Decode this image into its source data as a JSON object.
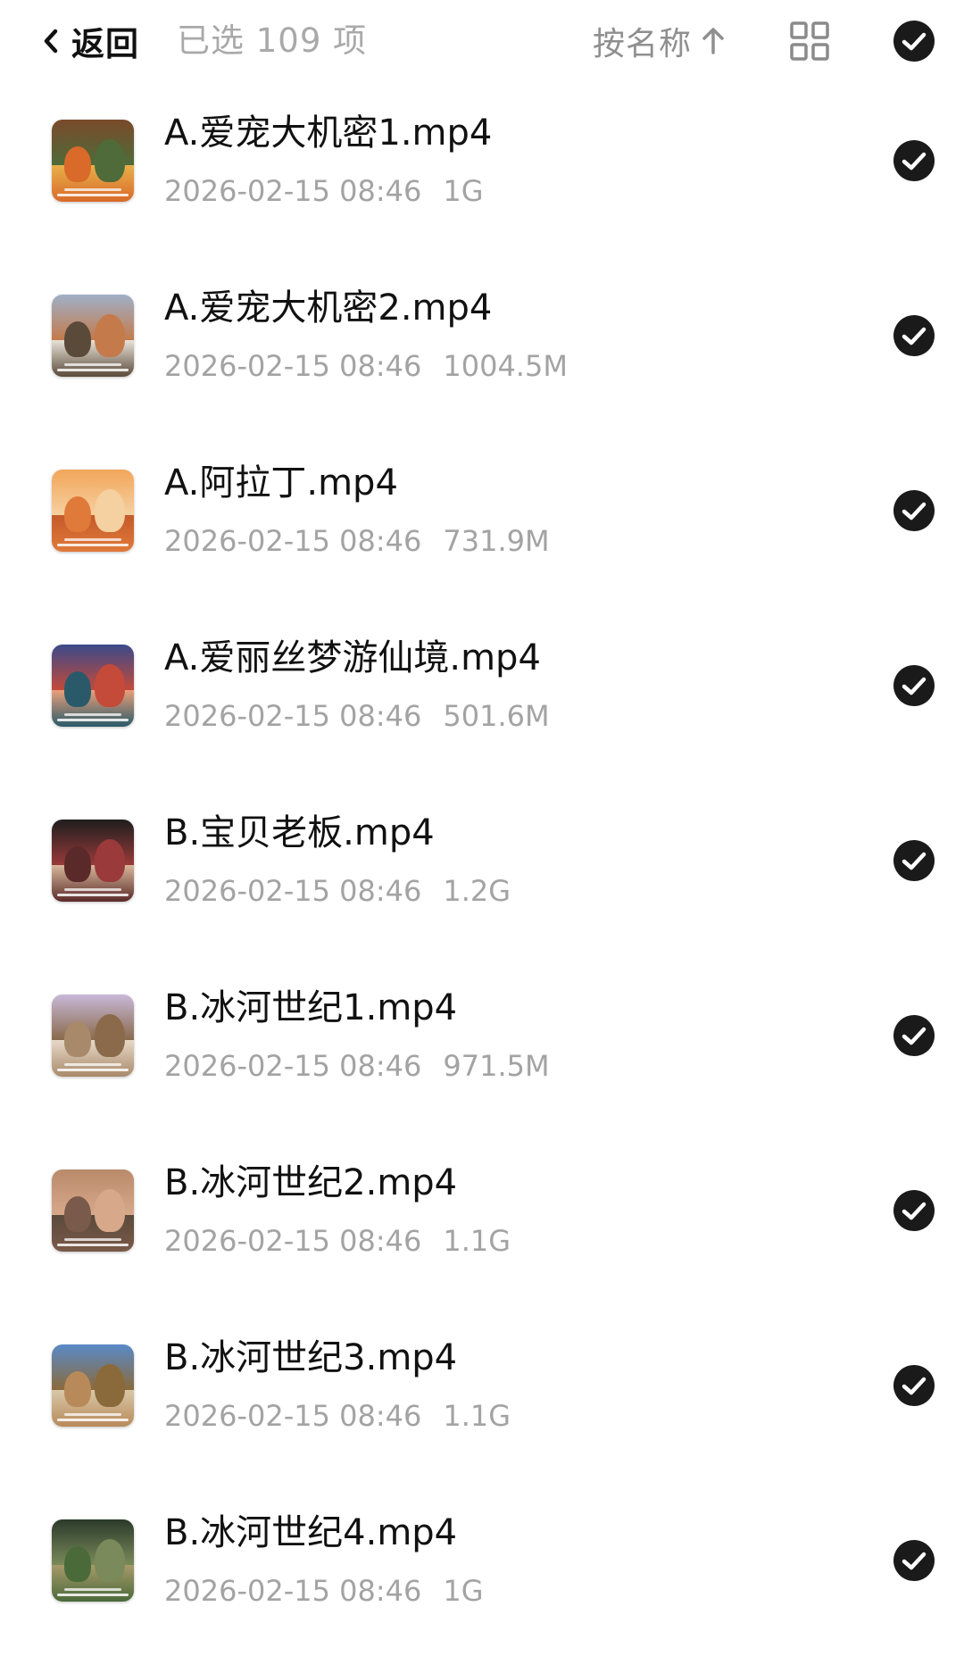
{
  "header": {
    "back_label": "返回",
    "selected_count": "已选 109 项",
    "sort_label": "按名称",
    "sort_icon": "arrow-up-icon",
    "view_icon": "grid-view-icon",
    "select_all_icon": "check-circle-icon"
  },
  "files": [
    {
      "name": "A.爱宠大机密1.mp4",
      "date": "2026-02-15 08:46",
      "size": "1G",
      "thumb_colors": [
        "#7a4a2a",
        "#d96a2a",
        "#4f6b3a",
        "#e8b04a"
      ]
    },
    {
      "name": "A.爱宠大机密2.mp4",
      "date": "2026-02-15 08:46",
      "size": "1004.5M",
      "thumb_colors": [
        "#9fb0c8",
        "#5a4a3a",
        "#c47a4a",
        "#e9e3d8"
      ]
    },
    {
      "name": "A.阿拉丁.mp4",
      "date": "2026-02-15 08:46",
      "size": "731.9M",
      "thumb_colors": [
        "#f2a65a",
        "#e07a3a",
        "#f5d0a0",
        "#c45a2a"
      ]
    },
    {
      "name": "A.爱丽丝梦游仙境.mp4",
      "date": "2026-02-15 08:46",
      "size": "501.6M",
      "thumb_colors": [
        "#3a4a8a",
        "#2a5a6a",
        "#c44a3a",
        "#e9a07a"
      ]
    },
    {
      "name": "B.宝贝老板.mp4",
      "date": "2026-02-15 08:46",
      "size": "1.2G",
      "thumb_colors": [
        "#1e1e1e",
        "#5a2a2a",
        "#9a3a3a",
        "#d8b89a"
      ]
    },
    {
      "name": "B.冰河世纪1.mp4",
      "date": "2026-02-15 08:46",
      "size": "971.5M",
      "thumb_colors": [
        "#c8b8d8",
        "#a88a6a",
        "#8a6a4a",
        "#e8d8c8"
      ]
    },
    {
      "name": "B.冰河世纪2.mp4",
      "date": "2026-02-15 08:46",
      "size": "1.1G",
      "thumb_colors": [
        "#b88a6a",
        "#7a5a4a",
        "#d8a88a",
        "#5a4a3a"
      ]
    },
    {
      "name": "B.冰河世纪3.mp4",
      "date": "2026-02-15 08:46",
      "size": "1.1G",
      "thumb_colors": [
        "#5a8ac8",
        "#b88a5a",
        "#8a6a3a",
        "#d8c8a8"
      ]
    },
    {
      "name": "B.冰河世纪4.mp4",
      "date": "2026-02-15 08:46",
      "size": "1G",
      "thumb_colors": [
        "#2a3a2a",
        "#4a6a3a",
        "#7a8a5a",
        "#a89a6a"
      ]
    }
  ]
}
